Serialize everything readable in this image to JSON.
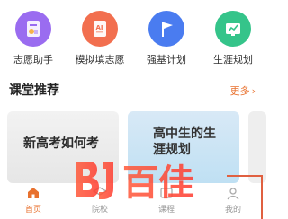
{
  "grid": [
    {
      "label": "志愿助手",
      "icon": "document-user-icon",
      "color": "#9a6cf0"
    },
    {
      "label": "模拟填志愿",
      "icon": "ai-document-icon",
      "color": "#f26f4f"
    },
    {
      "label": "强基计划",
      "icon": "flag-icon",
      "color": "#4a7cf0"
    },
    {
      "label": "生涯规划",
      "icon": "chart-board-icon",
      "color": "#35c48a"
    }
  ],
  "section": {
    "title": "课堂推荐",
    "more": "更多"
  },
  "cards": [
    {
      "text": "新高考如何考"
    },
    {
      "text": "高中生的生涯规划"
    }
  ],
  "tabs": [
    {
      "label": "首页",
      "icon": "home-icon",
      "active": true
    },
    {
      "label": "院校",
      "icon": "school-icon"
    },
    {
      "label": "课程",
      "icon": "course-icon"
    },
    {
      "label": "我的",
      "icon": "profile-icon"
    }
  ],
  "watermark": {
    "text": "百佳"
  }
}
